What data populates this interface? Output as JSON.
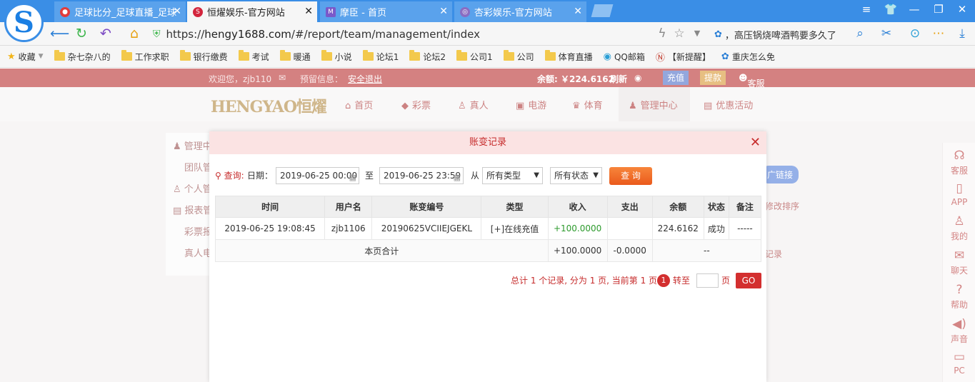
{
  "browser": {
    "tabs": [
      {
        "title": "足球比分_足球直播_足球",
        "active": false
      },
      {
        "title": "恒燿娱乐-官方网站",
        "active": true
      },
      {
        "title": "摩臣 - 首页",
        "active": false
      },
      {
        "title": "杏彩娱乐-官方网站",
        "active": false
      }
    ],
    "url_prefix": "https://",
    "url_host": "hengy1688.com",
    "url_path": "/#/report/team/management/index",
    "search_text": "，高压锅烧啤酒鸭要多久了",
    "bookmarks": [
      "收藏",
      "杂七杂八的",
      "工作求职",
      "银行缴费",
      "考试",
      "暖通",
      "小说",
      "论坛1",
      "论坛2",
      "公司1",
      "公司",
      "体育直播",
      "QQ邮箱",
      "【新提醒】",
      "重庆怎么免"
    ]
  },
  "site": {
    "topbar": {
      "welcome": "欢迎您，zjb110",
      "warning_label": "预留信息：",
      "logout": "安全退出",
      "balance": "余额: ￥224.6162",
      "refresh": "刷新",
      "deposit": "充值",
      "withdraw": "提款",
      "service": "客服"
    },
    "logo": "HENGYAO恒燿",
    "nav": [
      "首页",
      "彩票",
      "真人",
      "电游",
      "体育",
      "管理中心",
      "优惠活动"
    ],
    "side_menu": [
      "管理中",
      "团队管",
      "个人管",
      "报表管",
      "彩票报",
      "真人电"
    ],
    "right_bits": [
      "广链接",
      "修改排序",
      "记录"
    ],
    "right_sidebar": [
      "客服",
      "APP",
      "我的",
      "聊天",
      "帮助",
      "声音",
      "PC"
    ]
  },
  "modal": {
    "title": "账变记录",
    "query_label": "查询:",
    "date_label": "日期：",
    "date_from": "2019-06-25 00:00",
    "to_label": "至",
    "date_to": "2019-06-25 23:59",
    "from_label": "从",
    "type_select": "所有类型",
    "status_select": "所有状态",
    "query_button": "查 询",
    "columns": [
      "时间",
      "用户名",
      "账变编号",
      "类型",
      "收入",
      "支出",
      "余额",
      "状态",
      "备注"
    ],
    "rows": [
      [
        "2019-06-25 19:08:45",
        "zjb1106",
        "20190625VCIIEJGEKL",
        "[+]在线充值",
        "+100.0000",
        "",
        "224.6162",
        "成功",
        "-----"
      ]
    ],
    "total_row": {
      "label": "本页合计",
      "income": "+100.0000",
      "expense": "-0.0000",
      "rest": "--"
    },
    "pager": {
      "summary": "总计 1 个记录, 分为 1 页, 当前第 1 页",
      "current": "1",
      "goto": "转至",
      "page_unit": "页",
      "go": "GO"
    }
  }
}
